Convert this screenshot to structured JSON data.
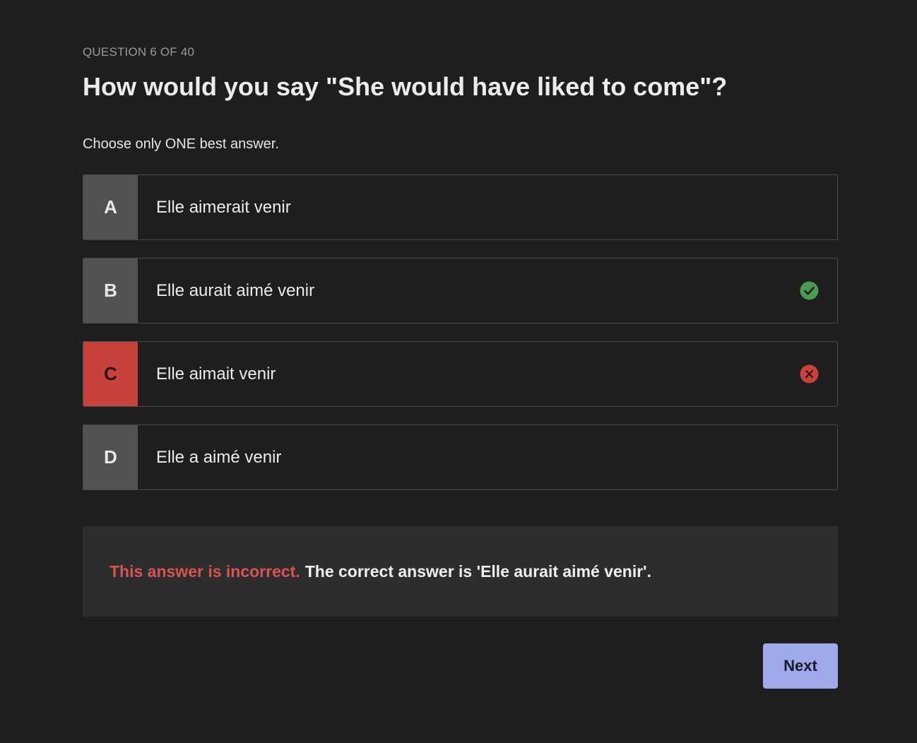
{
  "header": {
    "counter": "QUESTION 6 OF 40",
    "question": "How would you say \"She would have liked to come\"?"
  },
  "instruction": "Choose only ONE best answer.",
  "options": [
    {
      "letter": "A",
      "text": "Elle aimerait venir",
      "state": "neutral"
    },
    {
      "letter": "B",
      "text": "Elle aurait aimé venir",
      "state": "correct",
      "icon": "check-circle-icon"
    },
    {
      "letter": "C",
      "text": "Elle aimait venir",
      "state": "incorrect",
      "icon": "x-circle-icon"
    },
    {
      "letter": "D",
      "text": "Elle a aimé venir",
      "state": "neutral"
    }
  ],
  "feedback": {
    "status": "This answer is incorrect.",
    "detail": "The correct answer is 'Elle aurait aimé venir'."
  },
  "next_button": {
    "label": "Next"
  },
  "colors": {
    "background": "#1e1e1e",
    "correct": "#4a9a50",
    "incorrect": "#c9413c",
    "next_button": "#9ea8ea"
  }
}
